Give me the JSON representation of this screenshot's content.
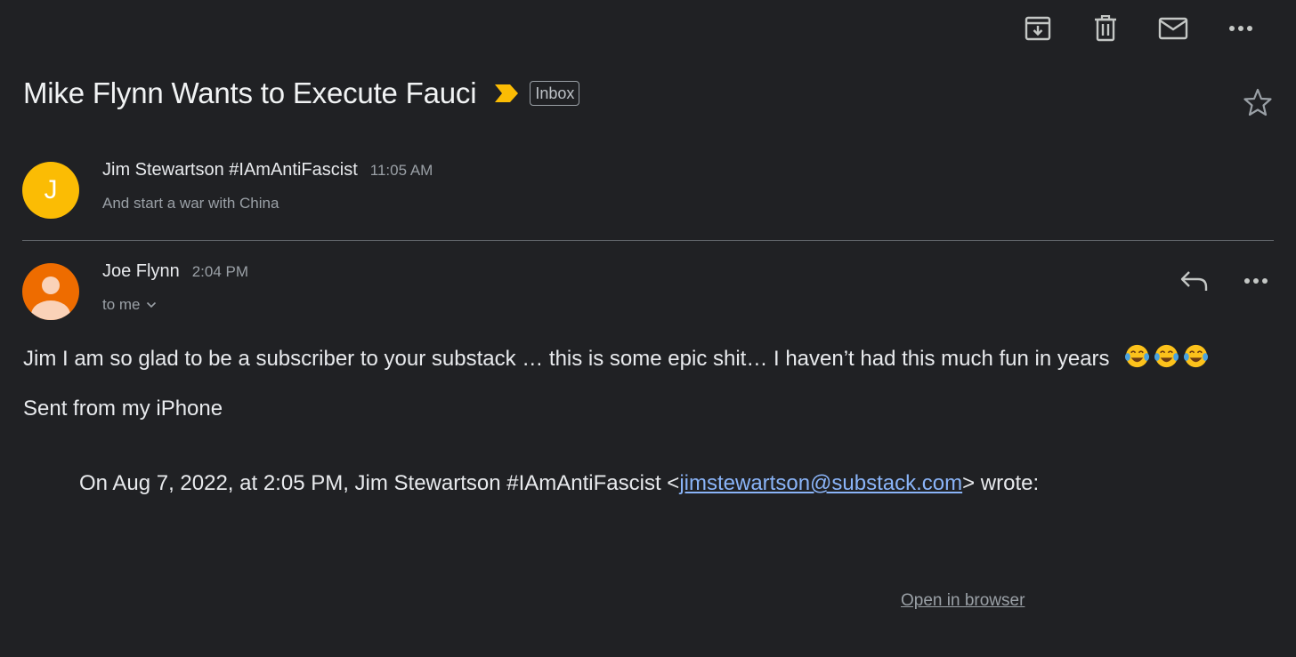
{
  "toolbar": {
    "icons": [
      "archive-icon",
      "trash-icon",
      "mark-unread-icon",
      "more-icon"
    ]
  },
  "thread": {
    "subject": "Mike Flynn Wants to Execute Fauci",
    "label": "Inbox",
    "importance_color": "#fbbc04"
  },
  "messages": [
    {
      "avatar_letter": "J",
      "avatar_color": "#fbbc04",
      "sender": "Jim Stewartson #IAmAntiFascist",
      "time": "11:05 AM",
      "snippet": "And start a war with China"
    },
    {
      "avatar_color": "#ee6c00",
      "sender": "Joe Flynn",
      "time": "2:04 PM",
      "recipient": "to me",
      "body": "Jim I am so glad to be a subscriber to your substack … this is some epic shit… I haven’t had this much fun in years",
      "emoji": "tears-of-joy-emoji x3",
      "signature": "Sent from my iPhone",
      "quote_prefix": "On Aug 7, 2022, at 2:05 PM, Jim Stewartson #IAmAntiFascist <",
      "quote_email": "jimstewartson@substack.com",
      "quote_suffix": "> wrote:"
    }
  ],
  "footer": {
    "open_in_browser": "Open in browser"
  }
}
